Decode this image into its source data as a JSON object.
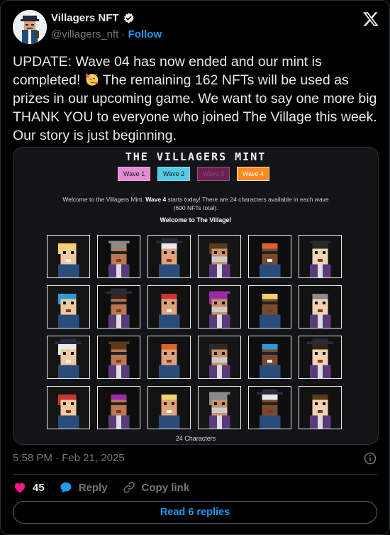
{
  "author": {
    "display_name": "Villagers NFT",
    "handle": "@villagers_nft",
    "separator": "·",
    "follow_label": "Follow",
    "verified": true
  },
  "tweet": {
    "text_part1": "UPDATE: Wave 04 has now ended and our mint is completed! ",
    "emoji": "partying-face-emoji",
    "text_part2": " The remaining 162 NFTs will be used as prizes in our upcoming game. We want to say one more big THANK YOU to everyone who joined The Village this week. Our story is just beginning."
  },
  "media": {
    "title": "THE VILLAGERS MINT",
    "waves": [
      "Wave 1",
      "Wave 2",
      "Wave 3",
      "Wave 4"
    ],
    "active_wave": "Wave 4",
    "welcome_prefix": "Welcome to the Villagers Mint. ",
    "welcome_wave": "Wave 4",
    "welcome_suffix": " starts today! There are 24 characters available in each wave (600 NFTs total).",
    "welcome_bold": "Welcome to The Village!",
    "characters_count": "24 Characters",
    "colors": {
      "wave1": "#e58bd6",
      "wave2": "#55cbe6",
      "wave3": "#6d2153",
      "wave4": "#ff8a1f"
    }
  },
  "meta": {
    "timestamp": "5:58 PM · Feb 21, 2025"
  },
  "actions": {
    "like_count": "45",
    "reply_label": "Reply",
    "copy_link_label": "Copy link",
    "read_replies_label": "Read 6 replies"
  },
  "colors": {
    "accent": "#1d9bf0",
    "like": "#f91880",
    "muted": "#71767b",
    "text": "#e7e9ea"
  }
}
